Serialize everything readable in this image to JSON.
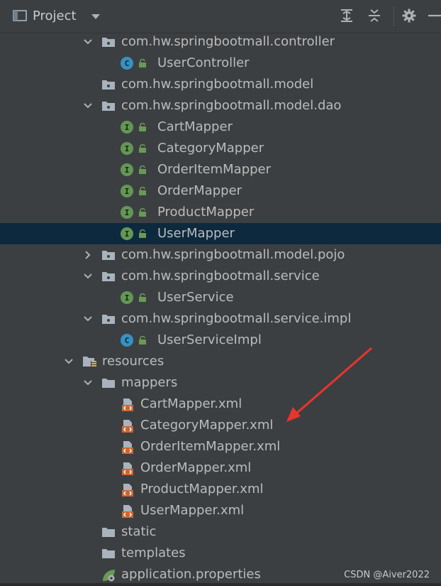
{
  "header": {
    "title": "Project",
    "icons": [
      "folder-window-icon",
      "dropdown-arrow-icon",
      "expand-all-icon",
      "collapse-all-icon",
      "gear-icon",
      "minimize-icon"
    ]
  },
  "tree": [
    {
      "label": "com.hw.springbootmall.controller",
      "kind": "package",
      "expanded": true
    },
    {
      "label": "UserController",
      "kind": "class"
    },
    {
      "label": "com.hw.springbootmall.model",
      "kind": "package"
    },
    {
      "label": "com.hw.springbootmall.model.dao",
      "kind": "package",
      "expanded": true
    },
    {
      "label": "CartMapper",
      "kind": "interface"
    },
    {
      "label": "CategoryMapper",
      "kind": "interface"
    },
    {
      "label": "OrderItemMapper",
      "kind": "interface"
    },
    {
      "label": "OrderMapper",
      "kind": "interface"
    },
    {
      "label": "ProductMapper",
      "kind": "interface"
    },
    {
      "label": "UserMapper",
      "kind": "interface",
      "selected": true
    },
    {
      "label": "com.hw.springbootmall.model.pojo",
      "kind": "package",
      "expanded": false
    },
    {
      "label": "com.hw.springbootmall.service",
      "kind": "package",
      "expanded": true
    },
    {
      "label": "UserService",
      "kind": "interface"
    },
    {
      "label": "com.hw.springbootmall.service.impl",
      "kind": "package",
      "expanded": true
    },
    {
      "label": "UserServiceImpl",
      "kind": "class"
    },
    {
      "label": "resources",
      "kind": "resources",
      "expanded": true
    },
    {
      "label": "mappers",
      "kind": "folder",
      "expanded": true
    },
    {
      "label": "CartMapper.xml",
      "kind": "xml"
    },
    {
      "label": "CategoryMapper.xml",
      "kind": "xml"
    },
    {
      "label": "OrderItemMapper.xml",
      "kind": "xml"
    },
    {
      "label": "OrderMapper.xml",
      "kind": "xml"
    },
    {
      "label": "ProductMapper.xml",
      "kind": "xml"
    },
    {
      "label": "UserMapper.xml",
      "kind": "xml"
    },
    {
      "label": "static",
      "kind": "folder"
    },
    {
      "label": "templates",
      "kind": "folder"
    },
    {
      "label": "application.properties",
      "kind": "properties"
    }
  ],
  "watermark": "CSDN @Aiver2022",
  "colors": {
    "background": "#3c3f41",
    "selection": "#0d293e",
    "interface_badge": "#629755",
    "class_badge": "#3592c4",
    "xml_badge": "#cc6633",
    "annotation_arrow": "#e8352c"
  }
}
